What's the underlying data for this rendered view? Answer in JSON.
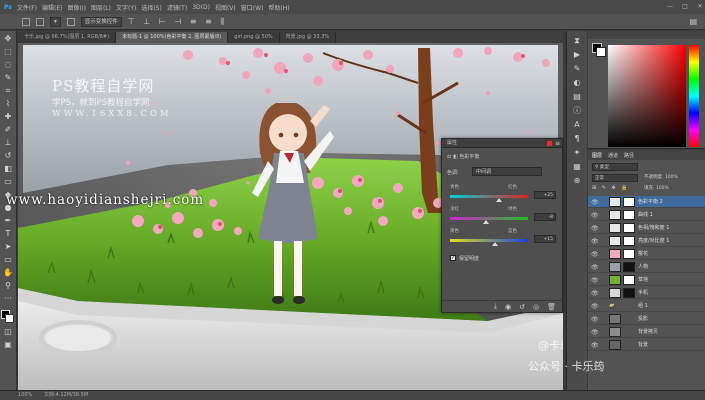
{
  "menubar": {
    "items": [
      "文件(F)",
      "编辑(E)",
      "图像(I)",
      "图层(L)",
      "文字(Y)",
      "选择(S)",
      "滤镜(T)",
      "3D(D)",
      "视图(V)",
      "窗口(W)",
      "帮助(H)"
    ],
    "window_controls": [
      "—",
      "□",
      "✕"
    ]
  },
  "optbar": {
    "chips": [
      "显示变换控件"
    ]
  },
  "tabs": [
    {
      "label": "卡乐.jpg @ 66.7%(图层 1, RGB/8#)",
      "active": false
    },
    {
      "label": "未标题-1 @ 100%(色彩平衡 2, 图层蒙版/8)",
      "active": true
    },
    {
      "label": "girl.png @ 50%",
      "active": false
    },
    {
      "label": "背景.jpg @ 33.3%",
      "active": false
    }
  ],
  "watermarks": {
    "brand_title": "PS教程自学网",
    "brand_sub": "学PS，就到PS教程自学网",
    "brand_url": "WWW.16XX8.COM",
    "site_url": "www.haoyidianshejri.com",
    "author_handle": "@卡乐筠",
    "author_account": "公众号 · 卡乐筠"
  },
  "properties": {
    "title": "属性",
    "adjust_name": "色彩平衡",
    "tone_label": "色调:",
    "tone_value": "中间调",
    "sliders": [
      {
        "left": "青色",
        "right": "红色",
        "value": "+25",
        "pos": 0.62,
        "gradient": [
          "#00d0d0",
          "#e02020"
        ]
      },
      {
        "left": "洋红",
        "right": "绿色",
        "value": "-8",
        "pos": 0.46,
        "gradient": [
          "#d020d0",
          "#20c020"
        ]
      },
      {
        "left": "黄色",
        "right": "蓝色",
        "value": "+15",
        "pos": 0.58,
        "gradient": [
          "#e0e020",
          "#2040e0"
        ]
      }
    ],
    "preserve_label": "保留明度"
  },
  "layers": {
    "tab_labels": [
      "图层",
      "通道",
      "路径"
    ],
    "blend_mode": "正常",
    "opacity_label": "不透明度: 100%",
    "fill_label": "填充: 100%",
    "rows": [
      {
        "name": "色彩平衡 2",
        "mask": true
      },
      {
        "name": "曲线 1",
        "mask": true
      },
      {
        "name": "色相/饱和度 1",
        "mask": true
      },
      {
        "name": "亮度/对比度 1",
        "mask": true
      },
      {
        "name": "樱花",
        "mask": true
      },
      {
        "name": "人物",
        "mask": true
      },
      {
        "name": "草地",
        "mask": true
      },
      {
        "name": "手机",
        "mask": true
      },
      {
        "name": "组 1",
        "mask": false
      },
      {
        "name": "投影",
        "mask": false
      },
      {
        "name": "背景拷贝",
        "mask": false
      },
      {
        "name": "背景",
        "mask": false
      }
    ]
  },
  "status": {
    "zoom": "100%",
    "doc": "文档:4.12M/38.5M"
  },
  "colors": {
    "accent": "#e03030",
    "grass": "#6fae2e",
    "sakura": "#f2a3b8"
  }
}
